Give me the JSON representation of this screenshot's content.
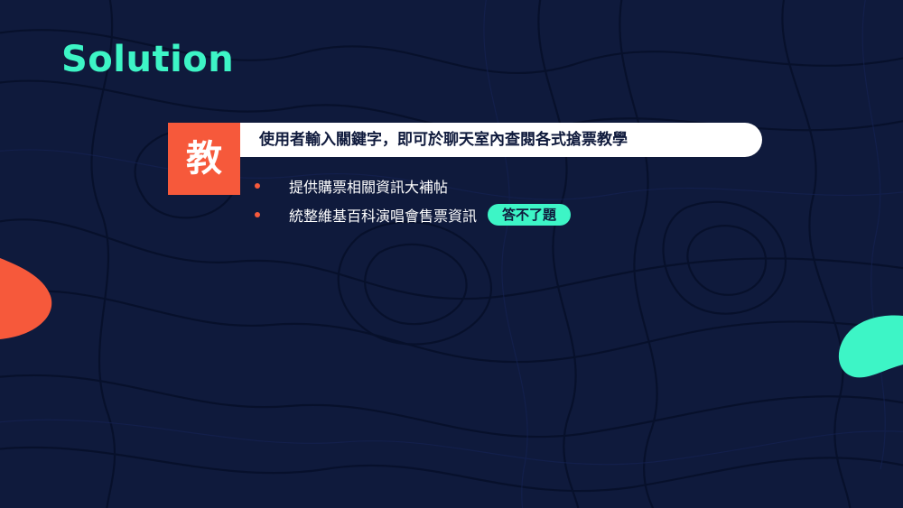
{
  "title": "Solution",
  "badge": {
    "char": "教"
  },
  "headline": "使用者輸入關鍵字，即可於聊天室內查閱各式搶票教學",
  "bullets": [
    {
      "text": "提供購票相關資訊大補帖"
    },
    {
      "text": "統整維基百科演唱會售票資訊",
      "tag": "答不了題"
    }
  ],
  "colors": {
    "background": "#0f1a3c",
    "accent_green": "#3df5c6",
    "accent_orange": "#f6593b",
    "pill": "#ffffff"
  }
}
